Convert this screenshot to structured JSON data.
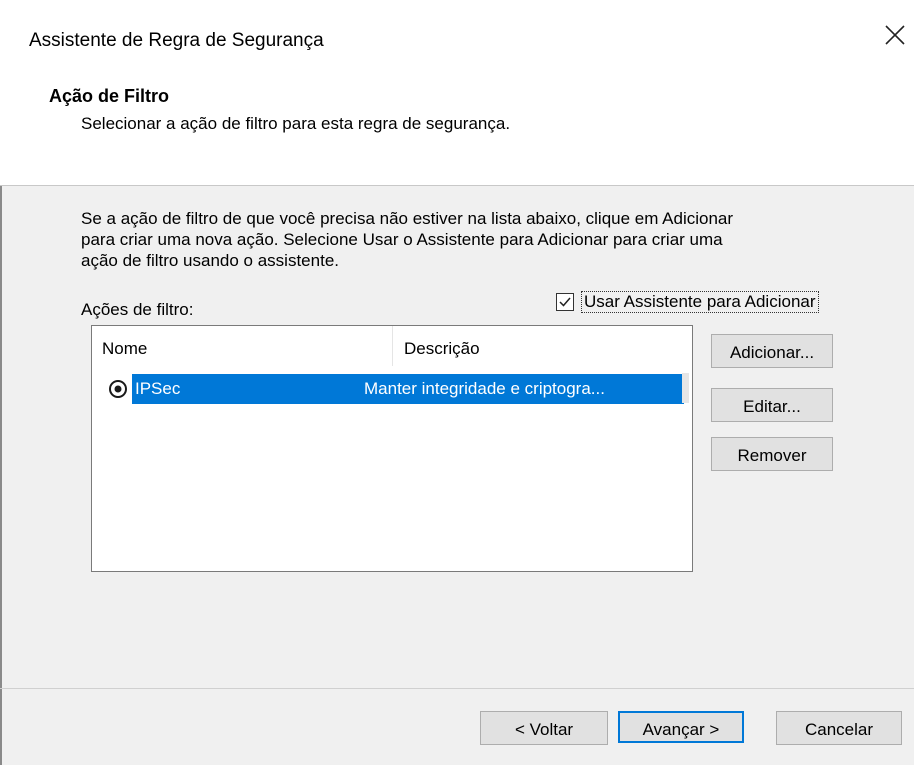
{
  "window": {
    "title": "Assistente de Regra de Segurança",
    "close_icon": "close-icon"
  },
  "header": {
    "title": "Ação de Filtro",
    "subtitle": "Selecionar a ação de filtro para esta regra de segurança."
  },
  "body": {
    "instructions": "Se a ação de filtro de que você precisa não estiver na lista abaixo, clique em Adicionar\npara criar uma nova ação. Selecione Usar o Assistente para Adicionar para criar uma\nação de filtro usando o assistente.",
    "list_label": "Ações de filtro:",
    "wizard_checkbox": {
      "label": "Usar Assistente para Adicionar",
      "checked": true
    }
  },
  "list": {
    "columns": [
      "Nome",
      "Descrição"
    ],
    "rows": [
      {
        "selected": true,
        "name": "IPSec",
        "description": "Manter integridade e criptogra...",
        "icon": "radio-selected-icon"
      }
    ]
  },
  "side_buttons": {
    "add": "Adicionar...",
    "edit": "Editar...",
    "remove": "Remover"
  },
  "footer": {
    "back": "< Voltar",
    "next": "Avançar >",
    "cancel": "Cancelar"
  },
  "colors": {
    "selection": "#0078d7",
    "dialog_bg": "#f0f0f0",
    "header_bg": "#ffffff"
  }
}
